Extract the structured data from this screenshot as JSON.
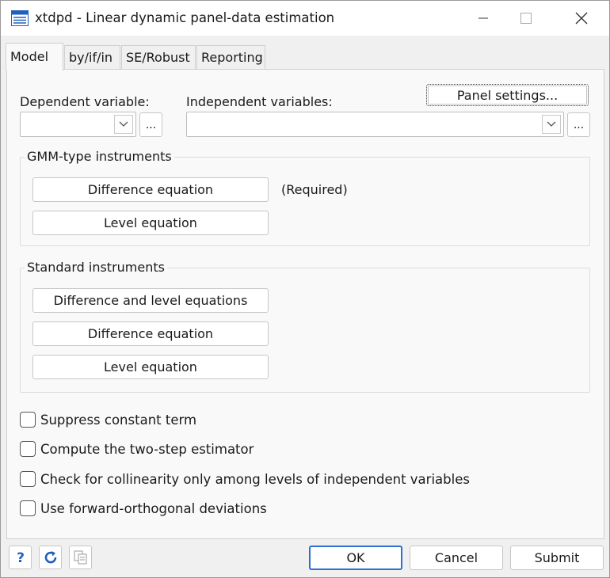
{
  "window": {
    "title": "xtdpd  -  Linear dynamic panel-data estimation"
  },
  "tabs": [
    {
      "label": "Model",
      "active": true
    },
    {
      "label": "by/if/in",
      "active": false
    },
    {
      "label": "SE/Robust",
      "active": false
    },
    {
      "label": "Reporting",
      "active": false
    }
  ],
  "model": {
    "panel_settings_label": "Panel settings...",
    "dependent_label": "Dependent variable:",
    "dependent_value": "",
    "independent_label": "Independent variables:",
    "independent_value": "",
    "browse_label": "...",
    "gmm_group": {
      "title": "GMM-type instruments",
      "difference_label": "Difference equation",
      "required_note": "(Required)",
      "level_label": "Level equation"
    },
    "standard_group": {
      "title": "Standard instruments",
      "diff_level_label": "Difference and level equations",
      "difference_label": "Difference equation",
      "level_label": "Level equation"
    },
    "options": [
      {
        "label": "Suppress constant term",
        "checked": false
      },
      {
        "label": "Compute the two-step estimator",
        "checked": false
      },
      {
        "label": "Check for collinearity only among levels of independent variables",
        "checked": false
      },
      {
        "label": "Use forward-orthogonal deviations",
        "checked": false
      }
    ]
  },
  "footer": {
    "help_icon": "help-icon",
    "reset_icon": "reset-icon",
    "copy_icon": "copy-icon",
    "ok_label": "OK",
    "cancel_label": "Cancel",
    "submit_label": "Submit"
  },
  "colors": {
    "accent": "#2b6fd6",
    "icon_blue": "#1f5fbf"
  }
}
